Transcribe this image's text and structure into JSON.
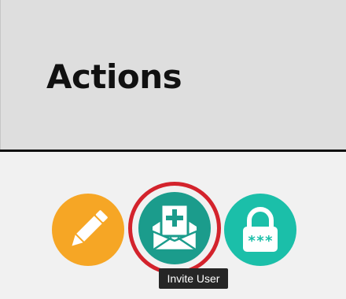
{
  "header": {
    "title": "Actions"
  },
  "actions": [
    {
      "icon": "pencil-icon",
      "color": "#f6a625"
    },
    {
      "icon": "envelope-plus-icon",
      "color": "#1b9c8c",
      "focused": true
    },
    {
      "icon": "lock-password-icon",
      "color": "#1bbfa9",
      "lock_text": "***"
    }
  ],
  "tooltip": {
    "text": "Invite User"
  },
  "colors": {
    "header_bg": "#dedede",
    "body_bg": "#f1f1f1",
    "focus_ring": "#d3232c",
    "tooltip_bg": "#262626"
  }
}
